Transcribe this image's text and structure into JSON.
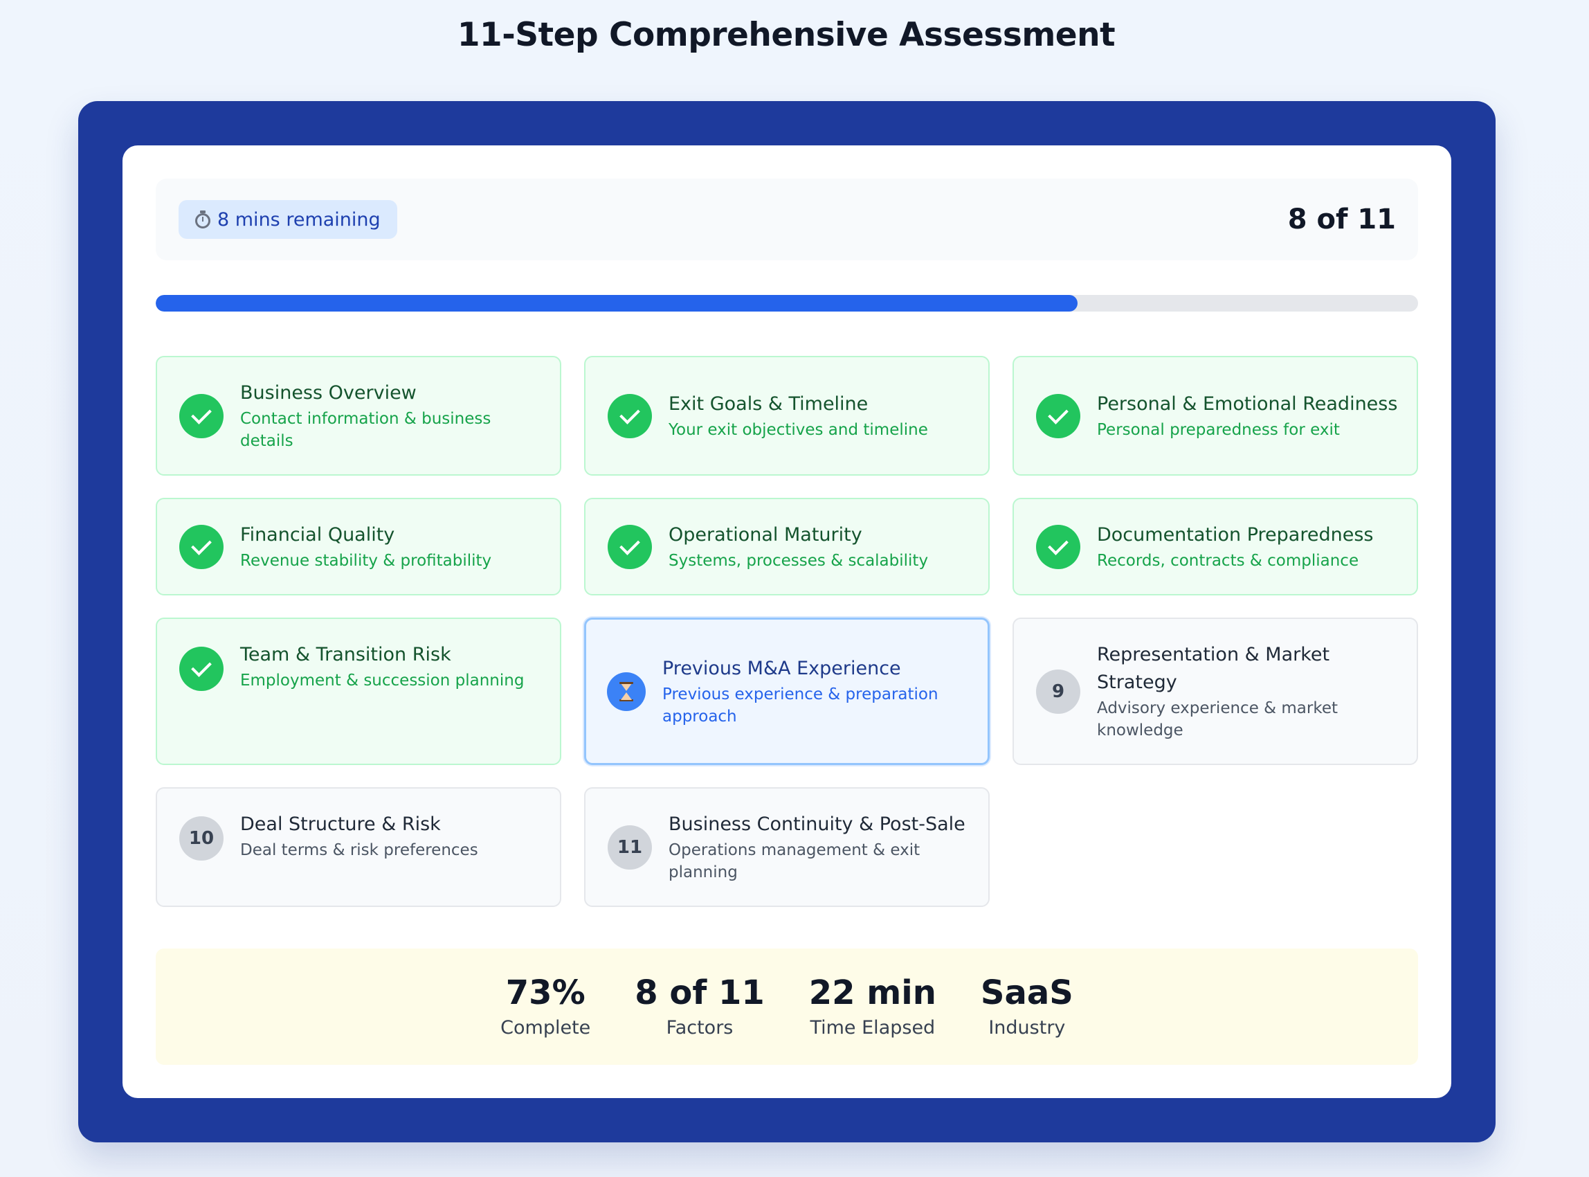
{
  "page": {
    "title": "11-Step Comprehensive Assessment"
  },
  "header": {
    "time_remaining": "8 mins remaining",
    "step_counter": "8 of 11"
  },
  "progress": {
    "percent": 73,
    "color": "#2563eb"
  },
  "steps": [
    {
      "number": "1",
      "status": "completed",
      "title": "Business Overview",
      "description": "Contact information & business details"
    },
    {
      "number": "2",
      "status": "completed",
      "title": "Exit Goals & Timeline",
      "description": "Your exit objectives and timeline"
    },
    {
      "number": "3",
      "status": "completed",
      "title": "Personal & Emotional Readiness",
      "description": "Personal preparedness for exit"
    },
    {
      "number": "4",
      "status": "completed",
      "title": "Financial Quality",
      "description": "Revenue stability & profitability"
    },
    {
      "number": "5",
      "status": "completed",
      "title": "Operational Maturity",
      "description": "Systems, processes & scalability"
    },
    {
      "number": "6",
      "status": "completed",
      "title": "Documentation Preparedness",
      "description": "Records, contracts & compliance"
    },
    {
      "number": "7",
      "status": "completed",
      "title": "Team & Transition Risk",
      "description": "Employment & succession planning"
    },
    {
      "number": "8",
      "status": "current",
      "title": "Previous M&A Experience",
      "description": "Previous experience & preparation approach"
    },
    {
      "number": "9",
      "status": "pending",
      "title": "Representation & Market Strategy",
      "description": "Advisory experience & market knowledge"
    },
    {
      "number": "10",
      "status": "pending",
      "title": "Deal Structure & Risk",
      "description": "Deal terms & risk preferences"
    },
    {
      "number": "11",
      "status": "pending",
      "title": "Business Continuity & Post-Sale",
      "description": "Operations management & exit planning"
    }
  ],
  "stats": [
    {
      "value": "73%",
      "label": "Complete"
    },
    {
      "value": "8 of 11",
      "label": "Factors"
    },
    {
      "value": "22 min",
      "label": "Time Elapsed"
    },
    {
      "value": "SaaS",
      "label": "Industry"
    }
  ],
  "colors": {
    "frame": "#1e3a9c",
    "completed_green": "#22c55e",
    "current_blue": "#3b82f6",
    "pending_gray": "#d1d5db",
    "stats_background": "#fefce8"
  },
  "icons": {
    "timer": "stopwatch-icon",
    "completed": "check-icon",
    "current": "hourglass-icon"
  }
}
